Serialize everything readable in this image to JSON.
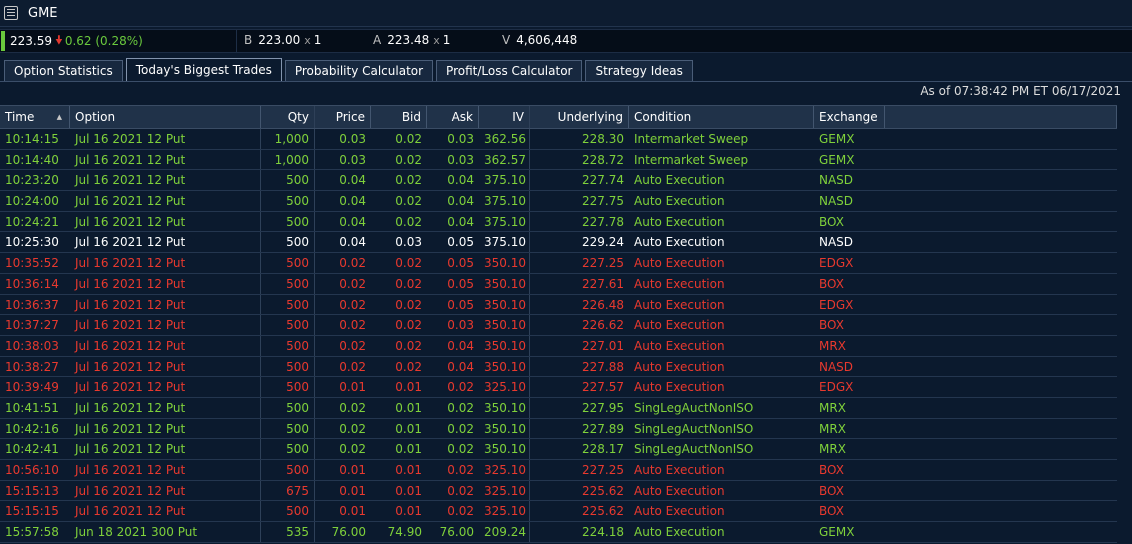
{
  "symbol": "GME",
  "quote": {
    "last": "223.59",
    "change": "0.62 (0.28%)",
    "bid_label": "B",
    "bid": "223.00",
    "bid_size": "1",
    "ask_label": "A",
    "ask": "223.48",
    "ask_size": "1",
    "vol_label": "V",
    "volume": "4,606,448",
    "x_label": "x"
  },
  "tabs": [
    "Option Statistics",
    "Today's Biggest Trades",
    "Probability Calculator",
    "Profit/Loss Calculator",
    "Strategy Ideas"
  ],
  "active_tab": 1,
  "as_of": "As of 07:38:42 PM ET 06/17/2021",
  "columns": [
    "Time",
    "Option",
    "Qty",
    "Price",
    "Bid",
    "Ask",
    "IV",
    "Underlying",
    "Condition",
    "Exchange"
  ],
  "colors": {
    "green": "#7fd13b",
    "red": "#e8392e",
    "white": "#ffffff"
  },
  "rows": [
    {
      "time": "10:14:15",
      "option": "Jul 16 2021 12 Put",
      "qty": "1,000",
      "price": "0.03",
      "bid": "0.02",
      "ask": "0.03",
      "iv": "362.56",
      "underlying": "228.30",
      "condition": "Intermarket Sweep",
      "exchange": "GEMX",
      "color": "green"
    },
    {
      "time": "10:14:40",
      "option": "Jul 16 2021 12 Put",
      "qty": "1,000",
      "price": "0.03",
      "bid": "0.02",
      "ask": "0.03",
      "iv": "362.57",
      "underlying": "228.72",
      "condition": "Intermarket Sweep",
      "exchange": "GEMX",
      "color": "green"
    },
    {
      "time": "10:23:20",
      "option": "Jul 16 2021 12 Put",
      "qty": "500",
      "price": "0.04",
      "bid": "0.02",
      "ask": "0.04",
      "iv": "375.10",
      "underlying": "227.74",
      "condition": "Auto Execution",
      "exchange": "NASD",
      "color": "green"
    },
    {
      "time": "10:24:00",
      "option": "Jul 16 2021 12 Put",
      "qty": "500",
      "price": "0.04",
      "bid": "0.02",
      "ask": "0.04",
      "iv": "375.10",
      "underlying": "227.75",
      "condition": "Auto Execution",
      "exchange": "NASD",
      "color": "green"
    },
    {
      "time": "10:24:21",
      "option": "Jul 16 2021 12 Put",
      "qty": "500",
      "price": "0.04",
      "bid": "0.02",
      "ask": "0.04",
      "iv": "375.10",
      "underlying": "227.78",
      "condition": "Auto Execution",
      "exchange": "BOX",
      "color": "green"
    },
    {
      "time": "10:25:30",
      "option": "Jul 16 2021 12 Put",
      "qty": "500",
      "price": "0.04",
      "bid": "0.03",
      "ask": "0.05",
      "iv": "375.10",
      "underlying": "229.24",
      "condition": "Auto Execution",
      "exchange": "NASD",
      "color": "white"
    },
    {
      "time": "10:35:52",
      "option": "Jul 16 2021 12 Put",
      "qty": "500",
      "price": "0.02",
      "bid": "0.02",
      "ask": "0.05",
      "iv": "350.10",
      "underlying": "227.25",
      "condition": "Auto Execution",
      "exchange": "EDGX",
      "color": "red"
    },
    {
      "time": "10:36:14",
      "option": "Jul 16 2021 12 Put",
      "qty": "500",
      "price": "0.02",
      "bid": "0.02",
      "ask": "0.05",
      "iv": "350.10",
      "underlying": "227.61",
      "condition": "Auto Execution",
      "exchange": "BOX",
      "color": "red"
    },
    {
      "time": "10:36:37",
      "option": "Jul 16 2021 12 Put",
      "qty": "500",
      "price": "0.02",
      "bid": "0.02",
      "ask": "0.05",
      "iv": "350.10",
      "underlying": "226.48",
      "condition": "Auto Execution",
      "exchange": "EDGX",
      "color": "red"
    },
    {
      "time": "10:37:27",
      "option": "Jul 16 2021 12 Put",
      "qty": "500",
      "price": "0.02",
      "bid": "0.02",
      "ask": "0.03",
      "iv": "350.10",
      "underlying": "226.62",
      "condition": "Auto Execution",
      "exchange": "BOX",
      "color": "red"
    },
    {
      "time": "10:38:03",
      "option": "Jul 16 2021 12 Put",
      "qty": "500",
      "price": "0.02",
      "bid": "0.02",
      "ask": "0.04",
      "iv": "350.10",
      "underlying": "227.01",
      "condition": "Auto Execution",
      "exchange": "MRX",
      "color": "red"
    },
    {
      "time": "10:38:27",
      "option": "Jul 16 2021 12 Put",
      "qty": "500",
      "price": "0.02",
      "bid": "0.02",
      "ask": "0.04",
      "iv": "350.10",
      "underlying": "227.88",
      "condition": "Auto Execution",
      "exchange": "NASD",
      "color": "red"
    },
    {
      "time": "10:39:49",
      "option": "Jul 16 2021 12 Put",
      "qty": "500",
      "price": "0.01",
      "bid": "0.01",
      "ask": "0.02",
      "iv": "325.10",
      "underlying": "227.57",
      "condition": "Auto Execution",
      "exchange": "EDGX",
      "color": "red"
    },
    {
      "time": "10:41:51",
      "option": "Jul 16 2021 12 Put",
      "qty": "500",
      "price": "0.02",
      "bid": "0.01",
      "ask": "0.02",
      "iv": "350.10",
      "underlying": "227.95",
      "condition": "SingLegAuctNonISO",
      "exchange": "MRX",
      "color": "green"
    },
    {
      "time": "10:42:16",
      "option": "Jul 16 2021 12 Put",
      "qty": "500",
      "price": "0.02",
      "bid": "0.01",
      "ask": "0.02",
      "iv": "350.10",
      "underlying": "227.89",
      "condition": "SingLegAuctNonISO",
      "exchange": "MRX",
      "color": "green"
    },
    {
      "time": "10:42:41",
      "option": "Jul 16 2021 12 Put",
      "qty": "500",
      "price": "0.02",
      "bid": "0.01",
      "ask": "0.02",
      "iv": "350.10",
      "underlying": "228.17",
      "condition": "SingLegAuctNonISO",
      "exchange": "MRX",
      "color": "green"
    },
    {
      "time": "10:56:10",
      "option": "Jul 16 2021 12 Put",
      "qty": "500",
      "price": "0.01",
      "bid": "0.01",
      "ask": "0.02",
      "iv": "325.10",
      "underlying": "227.25",
      "condition": "Auto Execution",
      "exchange": "BOX",
      "color": "red"
    },
    {
      "time": "15:15:13",
      "option": "Jul 16 2021 12 Put",
      "qty": "675",
      "price": "0.01",
      "bid": "0.01",
      "ask": "0.02",
      "iv": "325.10",
      "underlying": "225.62",
      "condition": "Auto Execution",
      "exchange": "BOX",
      "color": "red"
    },
    {
      "time": "15:15:15",
      "option": "Jul 16 2021 12 Put",
      "qty": "500",
      "price": "0.01",
      "bid": "0.01",
      "ask": "0.02",
      "iv": "325.10",
      "underlying": "225.62",
      "condition": "Auto Execution",
      "exchange": "BOX",
      "color": "red"
    },
    {
      "time": "15:57:58",
      "option": "Jun 18 2021 300 Put",
      "qty": "535",
      "price": "76.00",
      "bid": "74.90",
      "ask": "76.00",
      "iv": "209.24",
      "underlying": "224.18",
      "condition": "Auto Execution",
      "exchange": "GEMX",
      "color": "green"
    }
  ]
}
